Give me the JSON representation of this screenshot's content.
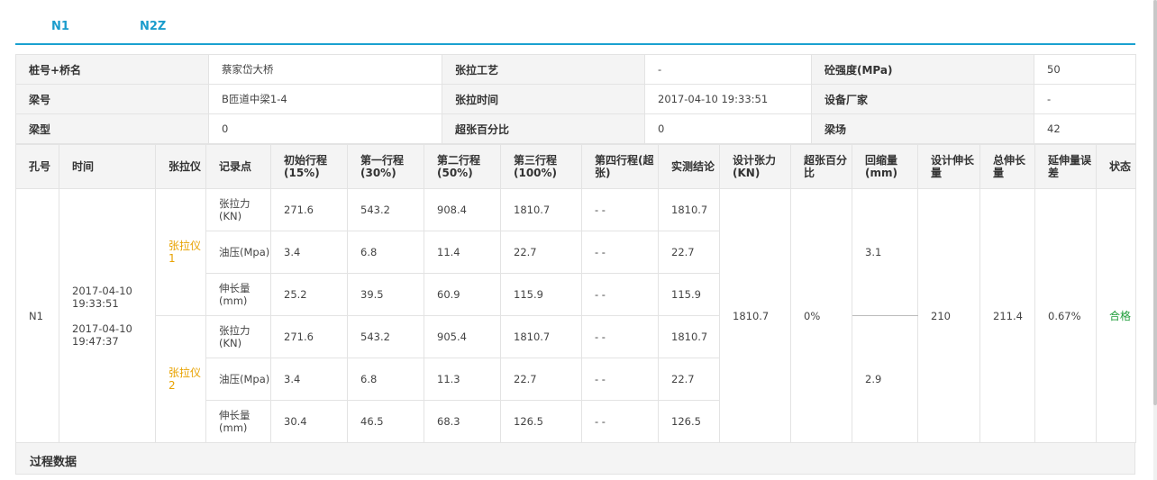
{
  "tabs": [
    "N1",
    "N2Z"
  ],
  "info": {
    "rows": [
      [
        {
          "label": "桩号+桥名",
          "value": "蔡家岱大桥"
        },
        {
          "label": "张拉工艺",
          "value": "-"
        },
        {
          "label": "砼强度(MPa)",
          "value": "50"
        }
      ],
      [
        {
          "label": "梁号",
          "value": "B匝道中梁1-4"
        },
        {
          "label": "张拉时间",
          "value": "2017-04-10 19:33:51"
        },
        {
          "label": "设备厂家",
          "value": "-"
        }
      ],
      [
        {
          "label": "梁型",
          "value": "0"
        },
        {
          "label": "超张百分比",
          "value": "0"
        },
        {
          "label": "梁场",
          "value": "42"
        }
      ]
    ]
  },
  "table": {
    "headers": [
      "孔号",
      "时间",
      "张拉仪",
      "记录点",
      "初始行程(15%)",
      "第一行程(30%)",
      "第二行程(50%)",
      "第三行程(100%)",
      "第四行程(超张)",
      "实测结论",
      "设计张力(KN)",
      "超张百分比",
      "回缩量(mm)",
      "设计伸长量",
      "总伸长量",
      "延伸量误差",
      "状态"
    ],
    "hole": "N1",
    "time1": "2017-04-10 19:33:51",
    "time2": "2017-04-10 19:47:37",
    "devices": [
      {
        "name": "张拉仪1",
        "retract": "3.1",
        "rows": [
          {
            "point": "张拉力(KN)",
            "v": [
              "271.6",
              "543.2",
              "908.4",
              "1810.7",
              "- -",
              "1810.7"
            ]
          },
          {
            "point": "油压(Mpa)",
            "v": [
              "3.4",
              "6.8",
              "11.4",
              "22.7",
              "- -",
              "22.7"
            ]
          },
          {
            "point": "伸长量(mm)",
            "v": [
              "25.2",
              "39.5",
              "60.9",
              "115.9",
              "- -",
              "115.9"
            ]
          }
        ]
      },
      {
        "name": "张拉仪2",
        "retract": "2.9",
        "rows": [
          {
            "point": "张拉力(KN)",
            "v": [
              "271.6",
              "543.2",
              "905.4",
              "1810.7",
              "- -",
              "1810.7"
            ]
          },
          {
            "point": "油压(Mpa)",
            "v": [
              "3.4",
              "6.8",
              "11.3",
              "22.7",
              "- -",
              "22.7"
            ]
          },
          {
            "point": "伸长量(mm)",
            "v": [
              "30.4",
              "46.5",
              "68.3",
              "126.5",
              "- -",
              "126.5"
            ]
          }
        ]
      }
    ],
    "design_force": "1810.7",
    "over_pct": "0%",
    "design_elong": "210",
    "total_elong": "211.4",
    "elong_err": "0.67%",
    "status": "合格"
  },
  "footer": {
    "title": "过程数据"
  }
}
